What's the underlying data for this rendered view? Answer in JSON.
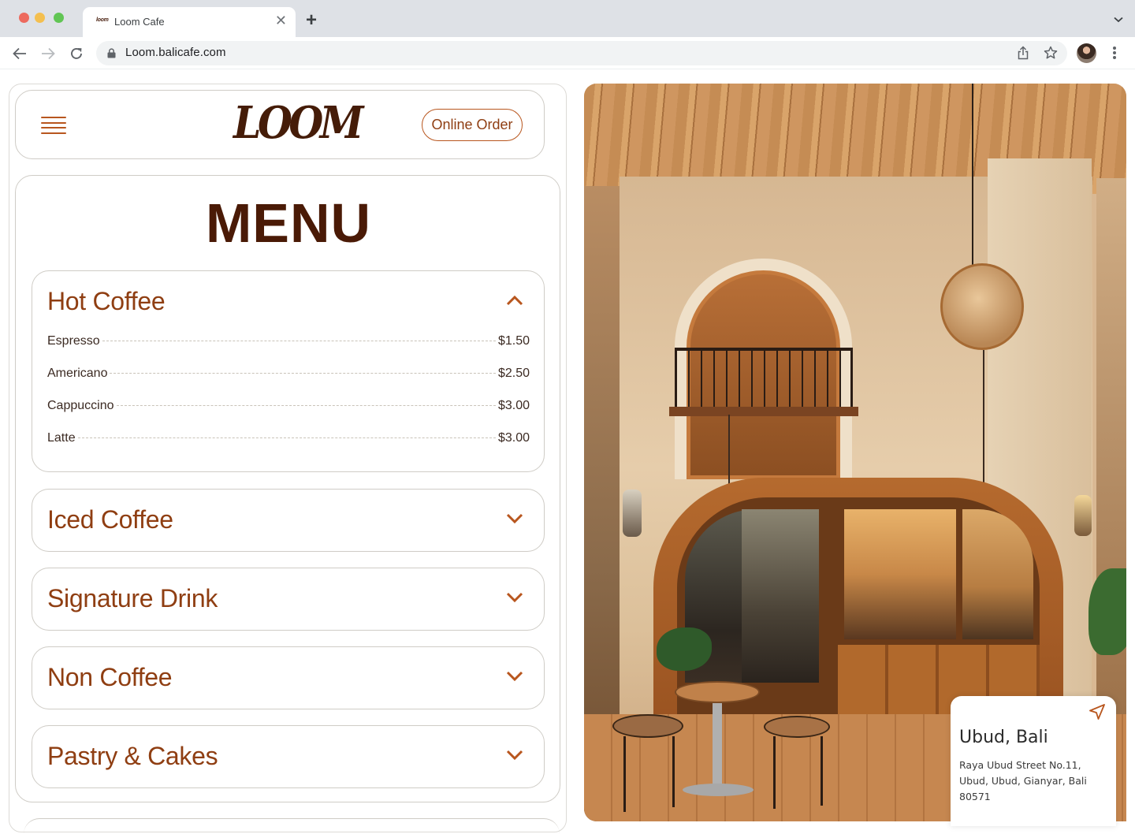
{
  "browser": {
    "tab_title": "Loom Cafe",
    "tab_favicon": "loom",
    "url": "Loom.balicafe.com",
    "icons": [
      "back-arrow-icon",
      "forward-arrow-icon",
      "reload-icon",
      "lock-icon",
      "share-icon",
      "star-icon",
      "profile-avatar",
      "more-vert-icon",
      "new-tab-plus-icon",
      "tab-close-icon",
      "tab-list-chevron-icon"
    ]
  },
  "header": {
    "logo": "LOOM",
    "menu_icon": "hamburger-icon",
    "order_button": "Online Order"
  },
  "menu": {
    "title": "MENU",
    "sections": [
      {
        "title": "Hot Coffee",
        "expanded": true,
        "icon": "chevron-up-icon",
        "items": [
          {
            "name": "Espresso",
            "price": "$1.50"
          },
          {
            "name": "Americano",
            "price": "$2.50"
          },
          {
            "name": "Cappuccino",
            "price": "$3.00"
          },
          {
            "name": "Latte",
            "price": "$3.00"
          }
        ]
      },
      {
        "title": "Iced Coffee",
        "expanded": false,
        "icon": "chevron-down-icon"
      },
      {
        "title": "Signature Drink",
        "expanded": false,
        "icon": "chevron-down-icon"
      },
      {
        "title": "Non Coffee",
        "expanded": false,
        "icon": "chevron-down-icon"
      },
      {
        "title": "Pastry & Cakes",
        "expanded": false,
        "icon": "chevron-down-icon"
      }
    ]
  },
  "location": {
    "city": "Ubud, Bali",
    "address": "Raya Ubud Street No.11, Ubud, Ubud, Gianyar, Bali 80571",
    "icon": "navigation-arrow-icon"
  },
  "colors": {
    "brand_dark": "#451c08",
    "accent": "#b8561e",
    "section_title": "#8f3e12",
    "border": "#cfccc6"
  }
}
